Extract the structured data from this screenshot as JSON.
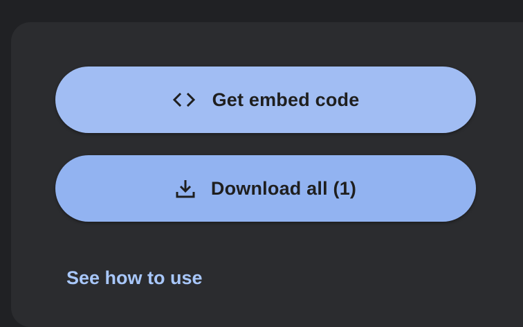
{
  "actions": {
    "embed_label": "Get embed code",
    "embed_icon": "code-icon",
    "download_label": "Download all (1)",
    "download_icon": "download-icon"
  },
  "help": {
    "link_label": "See how to use"
  },
  "colors": {
    "embed_button": "#a1bdf3",
    "download_button": "#92b3f1",
    "link": "#a8c7fa",
    "panel": "#2b2c2f",
    "background": "#202124"
  }
}
